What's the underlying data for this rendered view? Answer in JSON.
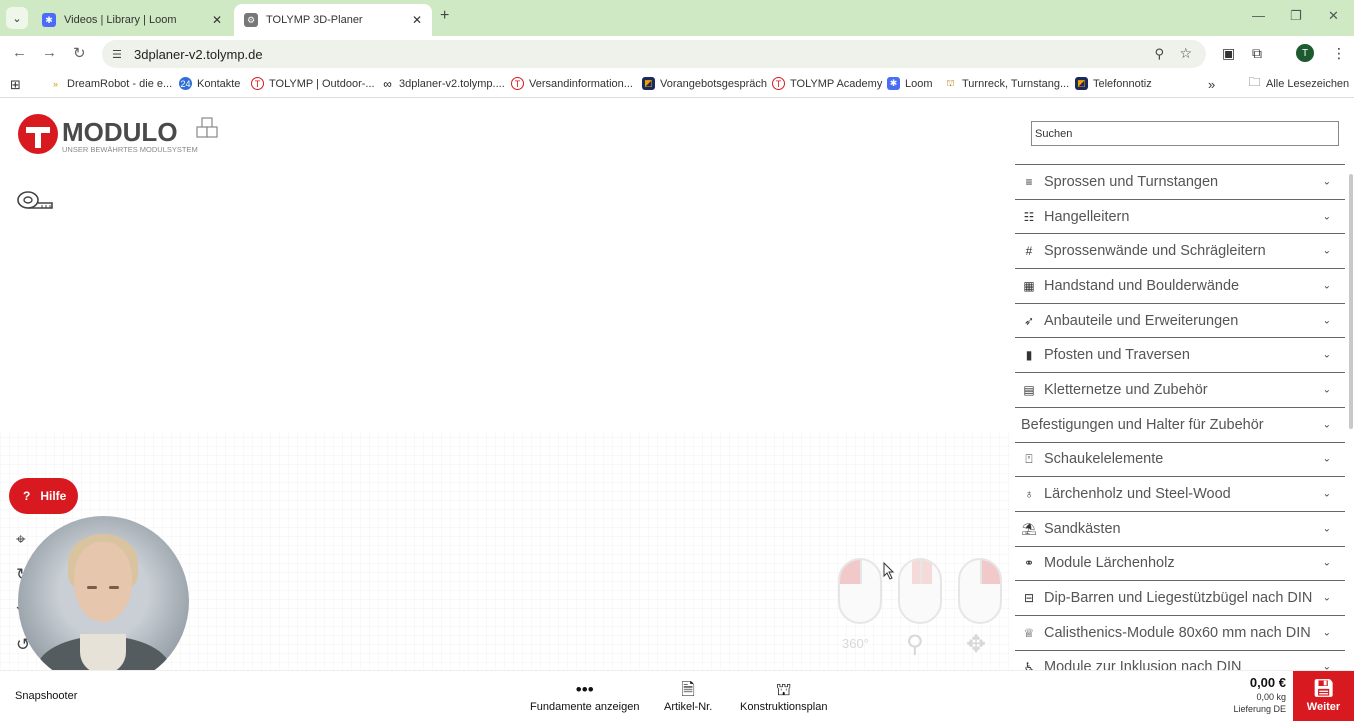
{
  "browser": {
    "tabs": [
      {
        "title": "Videos | Library | Loom",
        "active": false
      },
      {
        "title": "TOLYMP 3D-Planer",
        "active": true
      }
    ],
    "url": "3dplaner-v2.tolymp.de",
    "profile_initial": "T",
    "bookmarks": [
      {
        "label": "DreamRobot - die e...",
        "icon": "dreamrobot-icon"
      },
      {
        "label": "Kontakte",
        "icon": "contacts-icon"
      },
      {
        "label": "TOLYMP | Outdoor-...",
        "icon": "tolymp-icon"
      },
      {
        "label": "3dplaner-v2.tolymp....",
        "icon": "infinity-icon"
      },
      {
        "label": "Versandinformation...",
        "icon": "tolymp-icon"
      },
      {
        "label": "Vorangebotsgespräch",
        "icon": "vorangebot-icon"
      },
      {
        "label": "TOLYMP Academy",
        "icon": "tolymp-icon"
      },
      {
        "label": "Loom",
        "icon": "loom-icon"
      },
      {
        "label": "Turnreck, Turnstang...",
        "icon": "turnreck-icon"
      },
      {
        "label": "Telefonnotiz",
        "icon": "telefon-icon"
      }
    ],
    "all_bookmarks_label": "Alle Lesezeichen"
  },
  "app": {
    "logo": {
      "title": "MODULO",
      "tagline": "UNSER BEWÄHRTES MODULSYSTEM"
    },
    "help_label": "Hilfe",
    "search_placeholder": "Suchen",
    "categories": [
      {
        "label": "Sprossen und Turnstangen",
        "icon": "filter-lines-icon"
      },
      {
        "label": "Hangelleitern",
        "icon": "ladder-icon"
      },
      {
        "label": "Sprossenwände und Schrägleitern",
        "icon": "hash-icon"
      },
      {
        "label": "Handstand und Boulderwände",
        "icon": "grid-icon"
      },
      {
        "label": "Anbauteile und Erweiterungen",
        "icon": "rocket-icon"
      },
      {
        "label": "Pfosten und Traversen",
        "icon": "bar-chart-icon"
      },
      {
        "label": "Kletternetze und Zubehör",
        "icon": "net-icon"
      },
      {
        "label": "Befestigungen und Halter für Zubehör",
        "icon": ""
      },
      {
        "label": "Schaukelelemente",
        "icon": "swing-icon"
      },
      {
        "label": "Lärchenholz und Steel-Wood",
        "icon": "tree-icon"
      },
      {
        "label": "Sandkästen",
        "icon": "sandbox-icon"
      },
      {
        "label": "Module Lärchenholz",
        "icon": "module-icon"
      },
      {
        "label": "Dip-Barren und Liegestützbügel nach DIN",
        "icon": "dip-bar-icon"
      },
      {
        "label": "Calisthenics-Module 80x60 mm nach DIN",
        "icon": "trophy-icon"
      },
      {
        "label": "Module zur Inklusion nach DIN",
        "icon": "wheelchair-icon"
      }
    ],
    "footer": {
      "snapshooter": "Snapshooter",
      "fundamente": "Fundamente anzeigen",
      "artikel": "Artikel-Nr.",
      "konstruktion": "Konstruktionsplan",
      "price": "0,00 €",
      "weight": "0,00 kg",
      "delivery": "Lieferung DE",
      "weiter": "Weiter"
    },
    "accent_color": "#d81920"
  }
}
